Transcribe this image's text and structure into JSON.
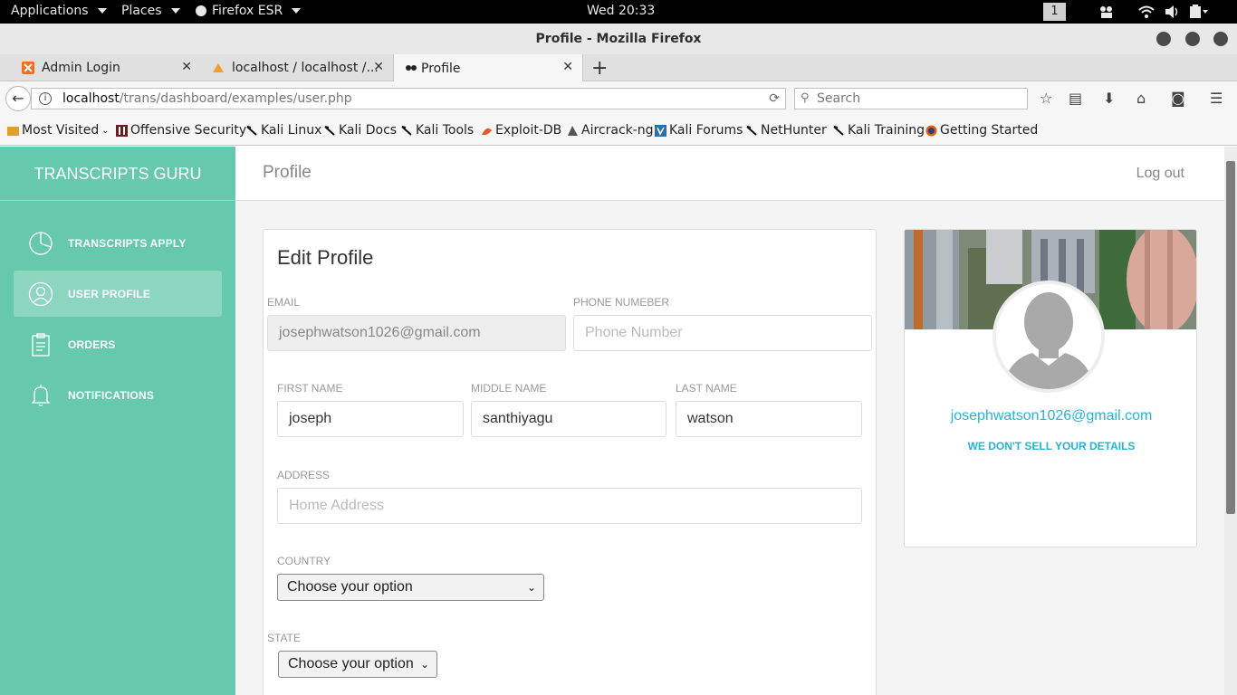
{
  "os_topbar": {
    "applications": "Applications",
    "places": "Places",
    "browser_app": "Firefox ESR",
    "clock": "Wed 20:33",
    "workspace": "1"
  },
  "window": {
    "title": "Profile - Mozilla Firefox"
  },
  "tabs": [
    {
      "label": "Admin Login",
      "favicon": "xampp-icon"
    },
    {
      "label": "localhost / localhost /...",
      "favicon": "phpmyadmin-icon"
    },
    {
      "label": "Profile",
      "favicon": "page-icon"
    }
  ],
  "navbar": {
    "url_host": "localhost",
    "url_path": "/trans/dashboard/examples/user.php",
    "search_placeholder": "Search"
  },
  "bookmarks": [
    {
      "label": "Most Visited",
      "icon": "folder-icon"
    },
    {
      "label": "Offensive Security",
      "icon": "offsec-icon"
    },
    {
      "label": "Kali Linux",
      "icon": "kali-icon"
    },
    {
      "label": "Kali Docs",
      "icon": "kali-icon"
    },
    {
      "label": "Kali Tools",
      "icon": "kali-icon"
    },
    {
      "label": "Exploit-DB",
      "icon": "exploitdb-icon"
    },
    {
      "label": "Aircrack-ng",
      "icon": "aircrack-icon"
    },
    {
      "label": "Kali Forums",
      "icon": "kali-forums-icon"
    },
    {
      "label": "NetHunter",
      "icon": "kali-icon"
    },
    {
      "label": "Kali Training",
      "icon": "kali-icon"
    },
    {
      "label": "Getting Started",
      "icon": "firefox-icon"
    }
  ],
  "sidebar": {
    "brand": "TRANSCRIPTS GURU",
    "items": [
      {
        "label": "TRANSCRIPTS APPLY",
        "icon": "pie-chart-icon",
        "active": false
      },
      {
        "label": "USER PROFILE",
        "icon": "user-icon",
        "active": true
      },
      {
        "label": "ORDERS",
        "icon": "clipboard-icon",
        "active": false
      },
      {
        "label": "NOTIFICATIONS",
        "icon": "bell-icon",
        "active": false
      }
    ]
  },
  "header": {
    "title": "Profile",
    "logout": "Log out"
  },
  "form": {
    "title": "Edit Profile",
    "email_label": "EMAIL",
    "email_value": "josephwatson1026@gmail.com",
    "phone_label": "PHONE NUMEBER",
    "phone_placeholder": "Phone Number",
    "first_name_label": "FIRST NAME",
    "first_name_value": "joseph",
    "middle_name_label": "MIDDLE NAME",
    "middle_name_value": "santhiyagu",
    "last_name_label": "LAST NAME",
    "last_name_value": "watson",
    "address_label": "ADDRESS",
    "address_placeholder": "Home Address",
    "country_label": "COUNTRY",
    "country_value": "Choose your option",
    "state_label": "STATE",
    "state_value": "Choose your option"
  },
  "profile_card": {
    "email": "josephwatson1026@gmail.com",
    "note": "WE DON'T SELL YOUR DETAILS"
  },
  "colors": {
    "sidebar": "#66c8ad",
    "link": "#26b3d6"
  }
}
